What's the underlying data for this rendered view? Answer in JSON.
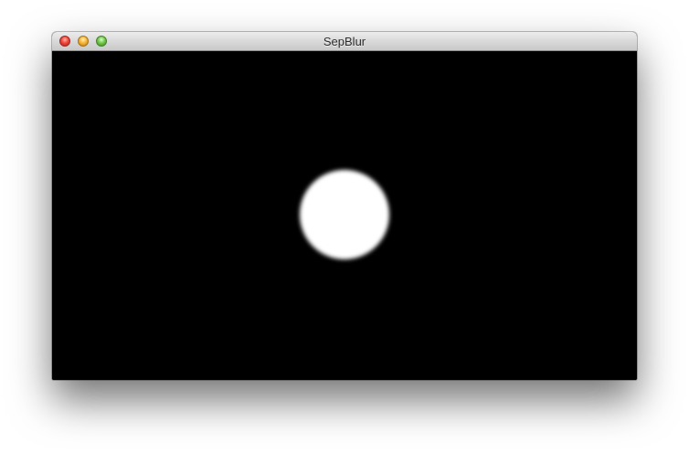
{
  "window": {
    "title": "SepBlur",
    "close_icon": "close-icon",
    "minimize_icon": "minimize-icon",
    "zoom_icon": "zoom-icon"
  },
  "canvas": {
    "background_color": "#000000",
    "disc_color": "#ffffff",
    "disc_shape": "blurred-circle"
  }
}
